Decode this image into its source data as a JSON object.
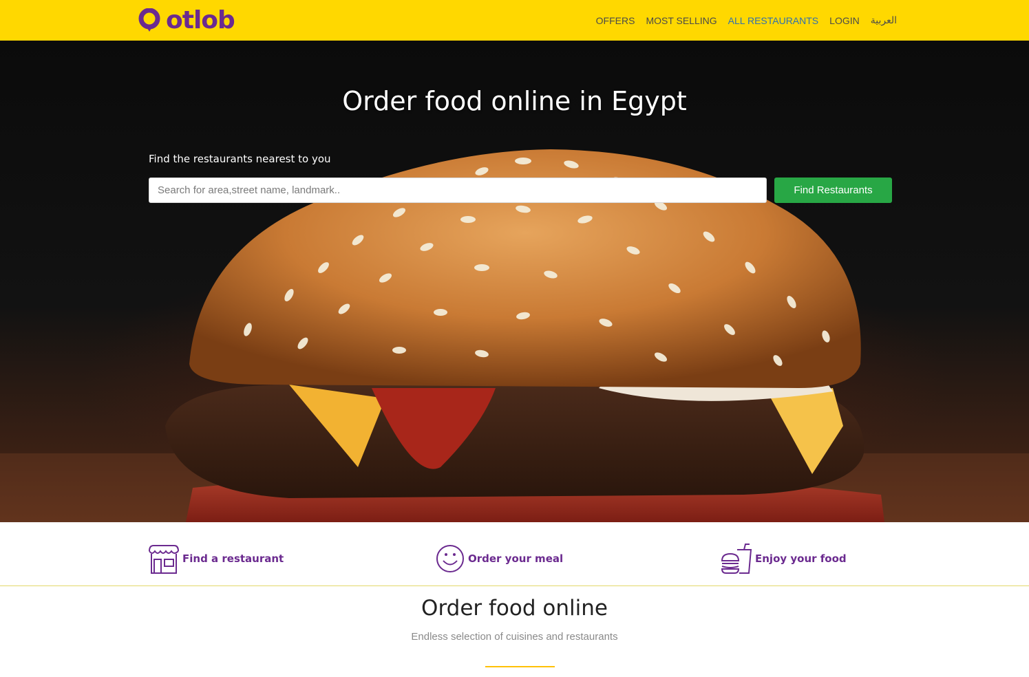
{
  "brand": {
    "name": "otlob",
    "accent": "#6b2a8f",
    "header_bg": "#ffd800",
    "cta_color": "#28a745"
  },
  "nav": {
    "items": [
      {
        "label": "OFFERS",
        "active": false
      },
      {
        "label": "MOST SELLING",
        "active": false
      },
      {
        "label": "ALL RESTAURANTS",
        "active": true
      },
      {
        "label": "LOGIN",
        "active": false
      },
      {
        "label": "العربية",
        "active": false
      }
    ]
  },
  "hero": {
    "title": "Order food online in Egypt",
    "search_label": "Find the restaurants nearest to you",
    "search_placeholder": "Search for area,street name, landmark..",
    "search_value": "",
    "button_label": "Find Restaurants",
    "image_icon": "burger-photo"
  },
  "steps": [
    {
      "label": "Find a restaurant",
      "icon": "storefront-icon"
    },
    {
      "label": "Order your meal",
      "icon": "smiley-icon"
    },
    {
      "label": "Enjoy your food",
      "icon": "burger-drink-icon"
    }
  ],
  "section": {
    "title": "Order food online",
    "subtitle": "Endless selection of cuisines and restaurants"
  }
}
